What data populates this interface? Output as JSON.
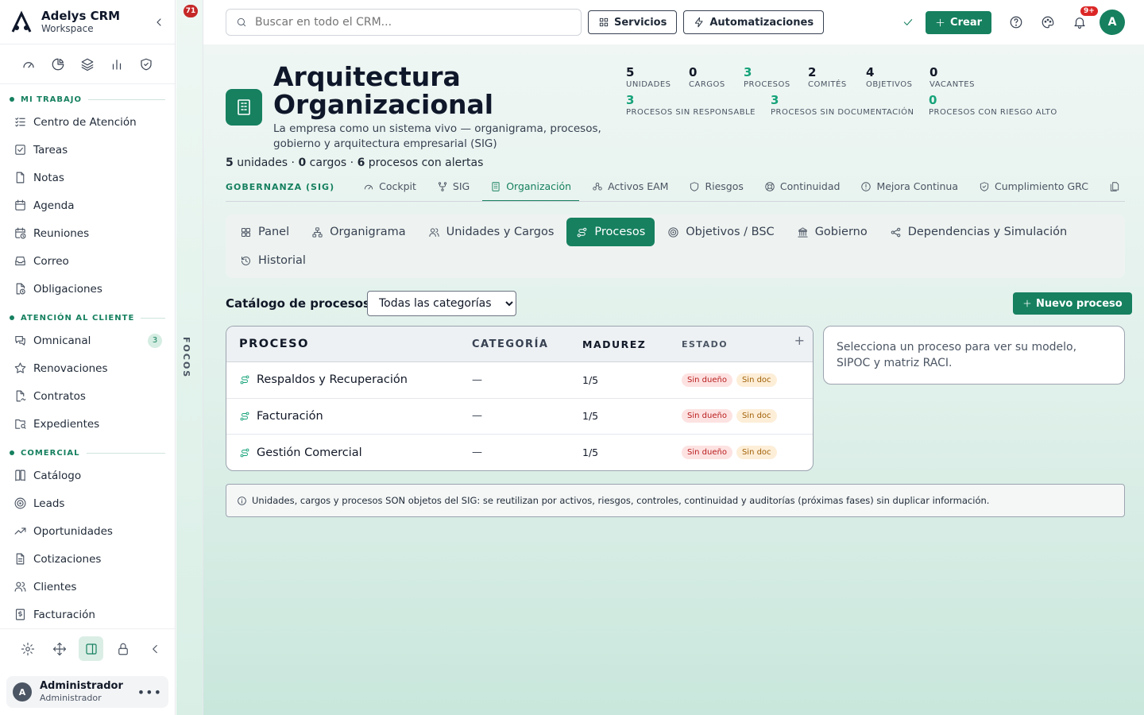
{
  "brand": {
    "name": "Adelys CRM",
    "workspace": "Workspace"
  },
  "sidebar": {
    "sections": [
      {
        "title": "MI TRABAJO",
        "items": [
          {
            "label": "Centro de Atención",
            "icon": "list-check-icon"
          },
          {
            "label": "Tareas",
            "icon": "square-check-icon"
          },
          {
            "label": "Notas",
            "icon": "file-icon"
          },
          {
            "label": "Agenda",
            "icon": "calendar-icon"
          },
          {
            "label": "Reuniones",
            "icon": "calendar-clock-icon"
          },
          {
            "label": "Correo",
            "icon": "inbox-icon"
          },
          {
            "label": "Obligaciones",
            "icon": "file-clock-icon"
          }
        ]
      },
      {
        "title": "ATENCIÓN AL CLIENTE",
        "items": [
          {
            "label": "Omnicanal",
            "icon": "messages-icon",
            "badge": "3"
          },
          {
            "label": "Renovaciones",
            "icon": "star-icon"
          },
          {
            "label": "Contratos",
            "icon": "file-signature-icon"
          },
          {
            "label": "Expedientes",
            "icon": "folder-search-icon"
          }
        ]
      },
      {
        "title": "COMERCIAL",
        "items": [
          {
            "label": "Catálogo",
            "icon": "book-icon"
          },
          {
            "label": "Leads",
            "icon": "target-icon"
          },
          {
            "label": "Oportunidades",
            "icon": "trending-up-icon"
          },
          {
            "label": "Cotizaciones",
            "icon": "file-text-icon"
          },
          {
            "label": "Clientes",
            "icon": "users-icon"
          },
          {
            "label": "Facturación",
            "icon": "receipt-icon"
          }
        ]
      }
    ],
    "user": {
      "name": "Administrador",
      "role": "Administrador",
      "initial": "A"
    }
  },
  "focos": {
    "label": "FOCOS",
    "badge": "71"
  },
  "topbar": {
    "search_placeholder": "Buscar en todo el CRM...",
    "servicios": "Servicios",
    "automatizaciones": "Automatizaciones",
    "crear": "Crear",
    "notif_badge": "9+",
    "avatar": "A"
  },
  "header": {
    "title": "Arquitectura Organizacional",
    "description": "La empresa como un sistema vivo — organigrama, procesos, gobierno y arquitectura empresarial (SIG)",
    "summary": {
      "units": "5",
      "units_label": "unidades",
      "posts": "0",
      "posts_label": "cargos",
      "alerts": "6",
      "alerts_label": "procesos con alertas"
    }
  },
  "stats": [
    {
      "value": "5",
      "label": "UNIDADES",
      "green": false
    },
    {
      "value": "0",
      "label": "CARGOS",
      "green": false
    },
    {
      "value": "3",
      "label": "PROCESOS",
      "green": true
    },
    {
      "value": "2",
      "label": "COMITÉS",
      "green": false
    },
    {
      "value": "4",
      "label": "OBJETIVOS",
      "green": false
    },
    {
      "value": "0",
      "label": "VACANTES",
      "green": false
    },
    {
      "value": "3",
      "label": "PROCESOS SIN RESPONSABLE",
      "green": true
    },
    {
      "value": "3",
      "label": "PROCESOS SIN DOCUMENTACIÓN",
      "green": true
    },
    {
      "value": "0",
      "label": "PROCESOS CON RIESGO ALTO",
      "green": true
    }
  ],
  "gov": {
    "label": "GOBERNANZA (SIG)",
    "tabs": [
      "Cockpit",
      "SIG",
      "Organización",
      "Activos EAM",
      "Riesgos",
      "Continuidad",
      "Mejora Continua",
      "Cumplimiento GRC",
      "Documentos"
    ],
    "active": "Organización"
  },
  "subtabs": [
    "Panel",
    "Organigrama",
    "Unidades y Cargos",
    "Procesos",
    "Objetivos / BSC",
    "Gobierno",
    "Dependencias y Simulación",
    "Historial"
  ],
  "catalog": {
    "title": "Catálogo de procesos",
    "filter": "Todas las categorías",
    "new_button": "Nuevo proceso",
    "columns": [
      "PROCESO",
      "CATEGORÍA",
      "MADUREZ",
      "ESTADO"
    ],
    "rows": [
      {
        "name": "Respaldos y Recuperación",
        "category": "—",
        "maturity": "1/5",
        "tags": [
          "Sin dueño",
          "Sin doc"
        ]
      },
      {
        "name": "Facturación",
        "category": "—",
        "maturity": "1/5",
        "tags": [
          "Sin dueño",
          "Sin doc"
        ]
      },
      {
        "name": "Gestión Comercial",
        "category": "—",
        "maturity": "1/5",
        "tags": [
          "Sin dueño",
          "Sin doc"
        ]
      }
    ],
    "detail_placeholder": "Selecciona un proceso para ver su modelo, SIPOC y matriz RACI."
  },
  "info": "Unidades, cargos y procesos SON objetos del SIG: se reutilizan por activos, riesgos, controles, continuidad y auditorías (próximas fases) sin duplicar información.",
  "colors": {
    "accent": "#16805f",
    "danger": "#dc2626"
  }
}
